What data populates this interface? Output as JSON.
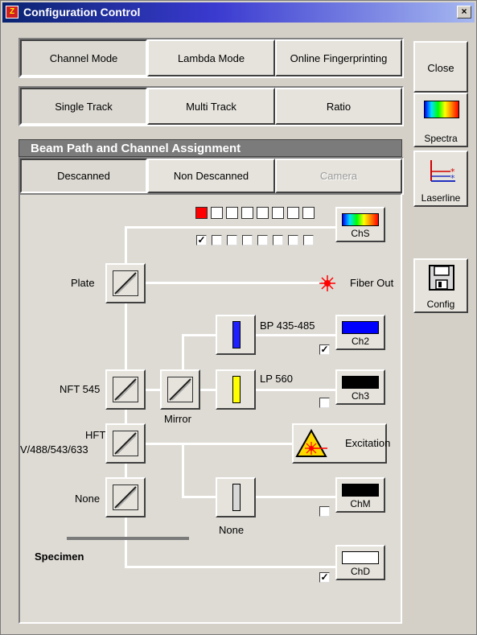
{
  "window": {
    "title": "Configuration Control",
    "close_glyph": "×"
  },
  "mode_tabs": [
    "Channel Mode",
    "Lambda Mode",
    "Online Fingerprinting"
  ],
  "track_tabs": [
    "Single Track",
    "Multi Track",
    "Ratio"
  ],
  "side": {
    "close": "Close",
    "spectra": "Spectra",
    "laserline": "Laserline",
    "config": "Config"
  },
  "beam_path": {
    "title": "Beam Path and Channel Assignment",
    "tabs": [
      "Descanned",
      "Non Descanned",
      "Camera"
    ],
    "labels": {
      "plate": "Plate",
      "fiber_out": "Fiber Out",
      "bp": "BP 435-485",
      "lp": "LP 560",
      "nft": "NFT 545",
      "mirror": "Mirror",
      "hft_line1": "HFT",
      "hft_line2": "V/488/543/633",
      "excitation": "Excitation",
      "none_left": "None",
      "none_filter": "None",
      "specimen": "Specimen"
    },
    "channels": {
      "chs": {
        "label": "ChS"
      },
      "ch2": {
        "label": "Ch2",
        "color": "#0000ff",
        "checked": true
      },
      "ch3": {
        "label": "Ch3",
        "color": "#000000",
        "checked": false
      },
      "chm": {
        "label": "ChM",
        "color": "#000000",
        "checked": false
      },
      "chd": {
        "label": "ChD",
        "color": "#ffffff",
        "checked": true
      }
    },
    "chs_checks": {
      "check_glyph": "✓",
      "states": [
        true,
        false,
        false,
        false,
        false,
        false,
        false,
        false
      ]
    },
    "chs_squares": [
      "#ff0000",
      "#ffffff",
      "#ffffff",
      "#ffffff",
      "#ffffff",
      "#ffffff",
      "#ffffff",
      "#ffffff"
    ]
  },
  "icons": [
    "spectra-icon",
    "laserline-icon",
    "floppy-disk-icon",
    "laser-warning-icon",
    "fiber-out-icon",
    "beam-splitter-icon"
  ]
}
